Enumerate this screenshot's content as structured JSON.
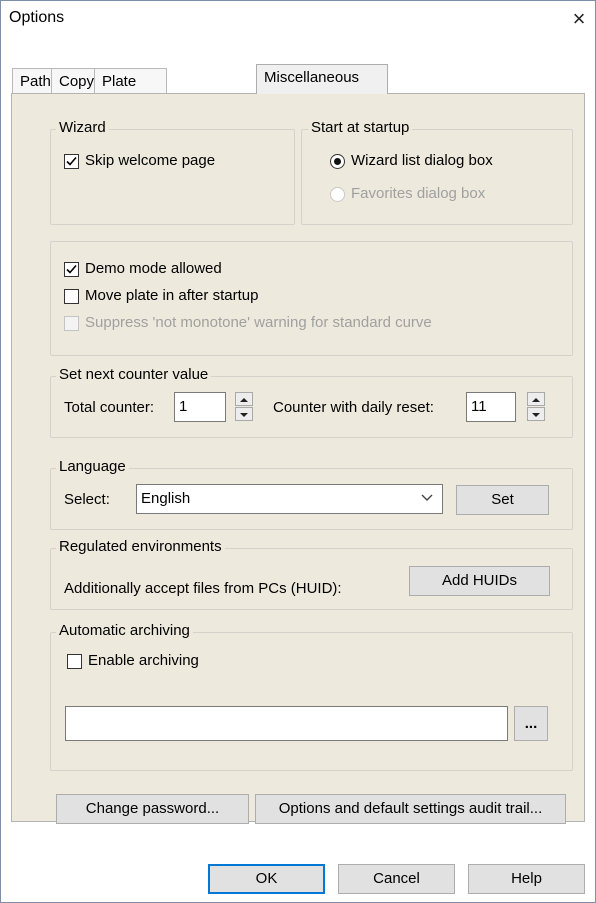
{
  "window": {
    "title": "Options",
    "close_label": "×"
  },
  "tabs": [
    "Paths",
    "Copy",
    "Plate View",
    "Miscellaneous"
  ],
  "wizard": {
    "label": "Wizard",
    "skip_welcome": "Skip welcome page",
    "skip_checked": true
  },
  "startup": {
    "label": "Start at startup",
    "option1": "Wizard list dialog box",
    "option2": "Favorites dialog box",
    "selected": "option1"
  },
  "misc": {
    "demo_mode": "Demo mode allowed",
    "demo_checked": true,
    "move_plate": "Move plate in after startup",
    "move_checked": false,
    "suppress": "Suppress 'not monotone' warning for standard curve",
    "suppress_enabled": false
  },
  "counter": {
    "label": "Set next counter value",
    "total_label": "Total counter:",
    "total_value": "1",
    "daily_label": "Counter with daily reset:",
    "daily_value": "11"
  },
  "language": {
    "label": "Language",
    "select_label": "Select:",
    "value": "English",
    "set_button": "Set"
  },
  "regulated": {
    "label": "Regulated environments",
    "text": "Additionally accept files from PCs (HUID):",
    "button": "Add HUIDs"
  },
  "archiving": {
    "label": "Automatic archiving",
    "enable": "Enable archiving",
    "enable_checked": false,
    "path_value": "",
    "browse_button": "..."
  },
  "actions": {
    "change_password": "Change password...",
    "audit_trail": "Options and default settings audit trail..."
  },
  "footer": {
    "ok": "OK",
    "cancel": "Cancel",
    "help": "Help"
  }
}
